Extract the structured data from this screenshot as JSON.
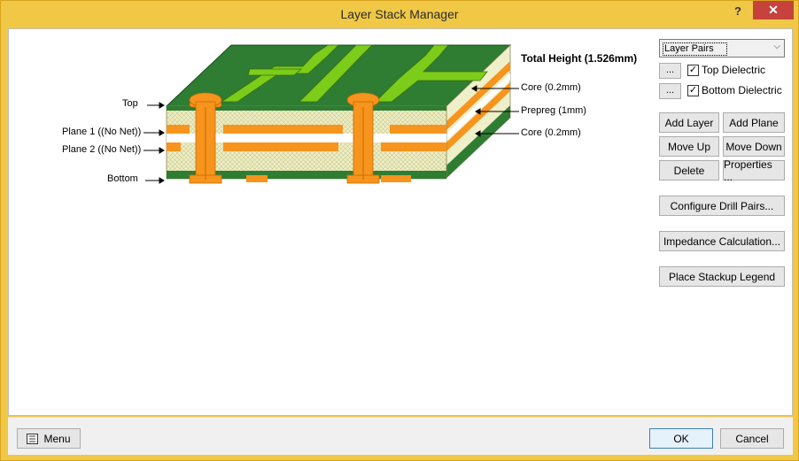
{
  "window": {
    "title": "Layer Stack Manager",
    "help": "?",
    "close": "✕"
  },
  "stack": {
    "total_height": "Total Height (1.526mm)",
    "left_labels": [
      "Top",
      "Plane 1 ((No Net))",
      "Plane 2 ((No Net))",
      "Bottom"
    ],
    "right_labels": [
      "Core (0.2mm)",
      "Prepreg (1mm)",
      "Core (0.2mm)"
    ]
  },
  "controls": {
    "layer_pairs": "Layer Pairs",
    "ellipsis": "...",
    "top_dielectric": "Top Dielectric",
    "top_dielectric_checked": true,
    "bottom_dielectric": "Bottom Dielectric",
    "bottom_dielectric_checked": true,
    "add_layer": "Add Layer",
    "add_plane": "Add Plane",
    "move_up": "Move Up",
    "move_down": "Move Down",
    "delete": "Delete",
    "properties": "Properties ...",
    "configure_drill_pairs": "Configure Drill Pairs...",
    "impedance_calculation": "Impedance Calculation...",
    "place_stackup_legend": "Place Stackup Legend"
  },
  "footer": {
    "menu": "Menu",
    "ok": "OK",
    "cancel": "Cancel"
  },
  "colors": {
    "title_bar": "#f0c846",
    "close_button": "#c7423c",
    "solder_mask_green": "#2e7d32",
    "trace_green": "#7ccc1a",
    "copper_orange": "#f7941d",
    "dielectric_cream": "#efefc9"
  },
  "icons": {
    "menu": "menu-icon",
    "check": "check-icon",
    "dropdown": "chevron-down-icon"
  }
}
